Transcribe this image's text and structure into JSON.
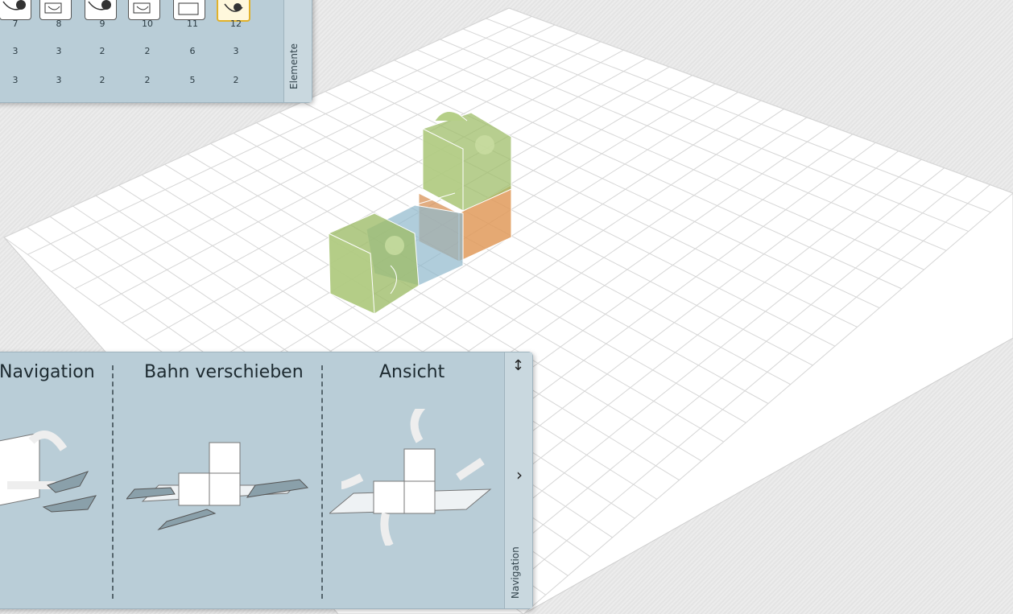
{
  "elements_panel": {
    "tab_label": "Elemente",
    "columns": [
      "7",
      "8",
      "9",
      "10",
      "11",
      "12"
    ],
    "row1": [
      "3",
      "3",
      "2",
      "2",
      "6",
      "3"
    ],
    "row2": [
      "3",
      "3",
      "2",
      "2",
      "5",
      "2"
    ],
    "selected_column": "12"
  },
  "nav_panel": {
    "tab_label": "Navigation",
    "sections": [
      "Navigation",
      "Bahn verschieben",
      "Ansicht"
    ],
    "resize_icon": "↕",
    "next_icon": "›"
  },
  "colors": {
    "green_block": "#9fbd6a",
    "blue_block": "#8fb8cc",
    "orange_block": "#e19a5b",
    "selected_border": "#e1b12a",
    "panel_bg": "#b9cdd7"
  }
}
